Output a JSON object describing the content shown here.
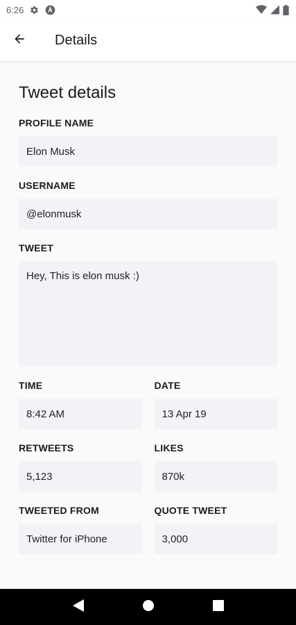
{
  "status_bar": {
    "time": "6:26",
    "icons_left": [
      "gear-icon",
      "a-badge-icon"
    ],
    "icons_right": [
      "wifi-icon",
      "signal-icon",
      "battery-icon"
    ]
  },
  "app_bar": {
    "back_icon": "arrow-left-icon",
    "title": "Details"
  },
  "content": {
    "section_title": "Tweet details",
    "fields": {
      "profile_name": {
        "label": "PROFILE NAME",
        "value": "Elon Musk"
      },
      "username": {
        "label": "USERNAME",
        "value": "@elonmusk"
      },
      "tweet": {
        "label": "TWEET",
        "value": "Hey, This is elon musk :)"
      },
      "time": {
        "label": "TIME",
        "value": "8:42 AM"
      },
      "date": {
        "label": "DATE",
        "value": "13 Apr 19"
      },
      "retweets": {
        "label": "RETWEETS",
        "value": "5,123"
      },
      "likes": {
        "label": "LIKES",
        "value": "870k"
      },
      "tweeted_from": {
        "label": "TWEETED FROM",
        "value": "Twitter for iPhone"
      },
      "quote_tweet": {
        "label": "QUOTE TWEET",
        "value": "3,000"
      }
    }
  },
  "nav_bar": {
    "buttons": [
      "back-triangle-icon",
      "home-circle-icon",
      "recents-square-icon"
    ]
  },
  "colors": {
    "field_background": "#f1f3f7",
    "content_background": "#fafafa",
    "nav_background": "#000000"
  }
}
